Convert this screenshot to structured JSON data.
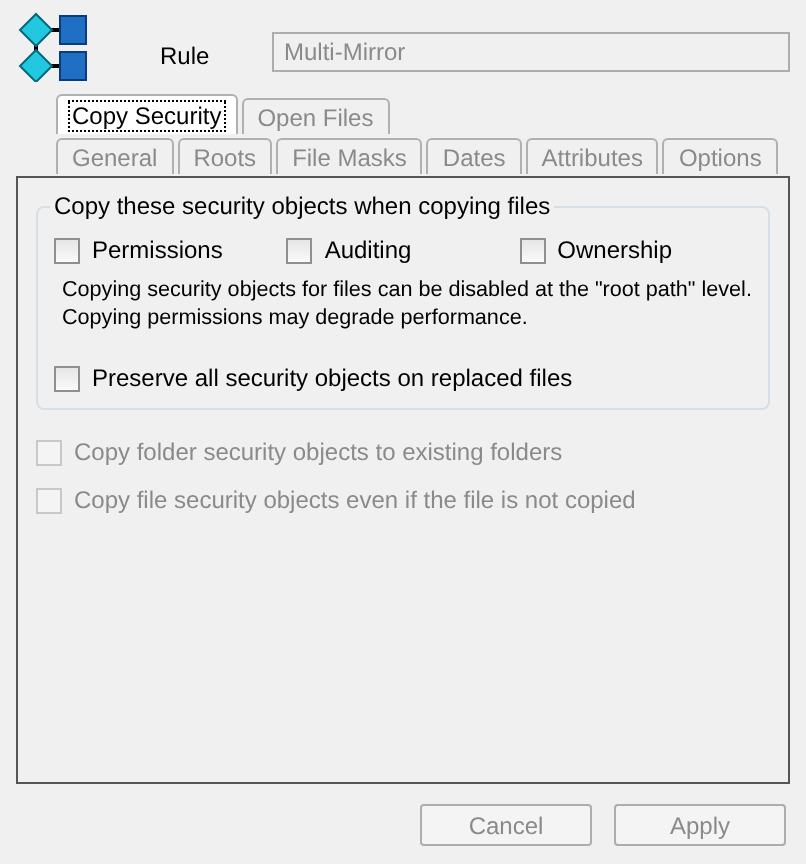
{
  "rule": {
    "label": "Rule",
    "value": "Multi-Mirror",
    "disabled": true
  },
  "tab_rows": [
    [
      {
        "label": "Copy Security",
        "selected": true
      },
      {
        "label": "Open Files",
        "selected": false
      }
    ],
    [
      {
        "label": "General",
        "selected": false
      },
      {
        "label": "Roots",
        "selected": false
      },
      {
        "label": "File Masks",
        "selected": false
      },
      {
        "label": "Dates",
        "selected": false
      },
      {
        "label": "Attributes",
        "selected": false
      },
      {
        "label": "Options",
        "selected": false
      }
    ]
  ],
  "group": {
    "title": "Copy these security objects when copying files",
    "options": [
      {
        "label": "Permissions",
        "checked": false
      },
      {
        "label": "Auditing",
        "checked": false
      },
      {
        "label": "Ownership",
        "checked": false
      }
    ],
    "note": [
      "Copying security objects for files can be disabled at the \"root path\" level.",
      "Copying permissions may degrade performance."
    ],
    "preserve": {
      "label": "Preserve all security objects on replaced files",
      "checked": false
    }
  },
  "extra_options": [
    {
      "label": "Copy folder security objects to existing folders",
      "checked": false,
      "disabled": true
    },
    {
      "label": "Copy file security objects even if the file is not copied",
      "checked": false,
      "disabled": true
    }
  ],
  "buttons": [
    {
      "label": "Cancel",
      "disabled": true
    },
    {
      "label": "Apply",
      "disabled": true
    }
  ]
}
